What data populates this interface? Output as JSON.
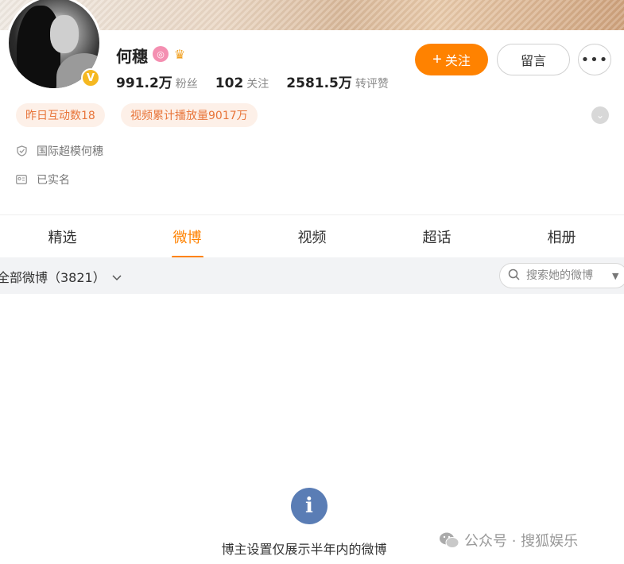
{
  "profile": {
    "name": "何穗",
    "verified_icon": "verified-v-icon",
    "stats": [
      {
        "num": "991.2万",
        "label": "粉丝"
      },
      {
        "num": "102",
        "label": "关注"
      },
      {
        "num": "2581.5万",
        "label": "转评赞"
      }
    ]
  },
  "actions": {
    "follow_label": "关注",
    "message_label": "留言",
    "more_label": "•••"
  },
  "tags": [
    "昨日互动数18",
    "视频累计播放量9017万"
  ],
  "info": {
    "title": "国际超模何穗",
    "realname": "已实名"
  },
  "tabs": [
    "精选",
    "微博",
    "视频",
    "超话",
    "相册"
  ],
  "active_tab": "微博",
  "filter": {
    "label": "全部微博（3821）",
    "search_placeholder": "搜索她的微博"
  },
  "notice": "博主设置仅展示半年内的微博",
  "watermark": "公众号 · 搜狐娱乐",
  "colors": {
    "accent": "#ff8200",
    "info_icon": "#5a7db5"
  }
}
